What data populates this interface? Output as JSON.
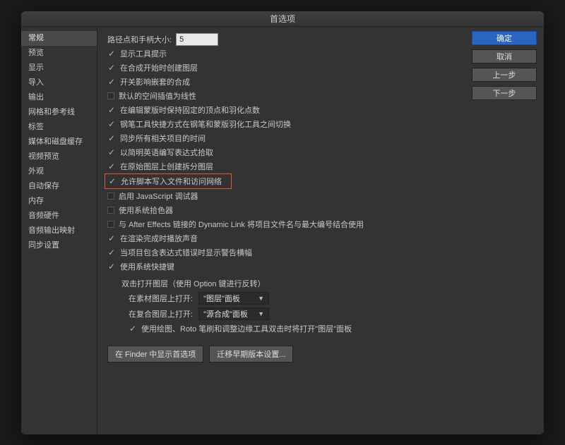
{
  "window": {
    "title": "首选项"
  },
  "sidebar": {
    "items": [
      {
        "label": "常规",
        "selected": true
      },
      {
        "label": "预览",
        "selected": false
      },
      {
        "label": "显示",
        "selected": false
      },
      {
        "label": "导入",
        "selected": false
      },
      {
        "label": "输出",
        "selected": false
      },
      {
        "label": "网格和参考线",
        "selected": false
      },
      {
        "label": "标签",
        "selected": false
      },
      {
        "label": "媒体和磁盘缓存",
        "selected": false
      },
      {
        "label": "视频预览",
        "selected": false
      },
      {
        "label": "外观",
        "selected": false
      },
      {
        "label": "自动保存",
        "selected": false
      },
      {
        "label": "内存",
        "selected": false
      },
      {
        "label": "音频硬件",
        "selected": false
      },
      {
        "label": "音频输出映射",
        "selected": false
      },
      {
        "label": "同步设置",
        "selected": false
      }
    ]
  },
  "buttons": {
    "ok": "确定",
    "cancel": "取消",
    "prev": "上一步",
    "next": "下一步"
  },
  "general": {
    "pathPointLabel": "路径点和手柄大小:",
    "pathPointValue": "5",
    "options": [
      {
        "checked": true,
        "label": "显示工具提示"
      },
      {
        "checked": true,
        "label": "在合成开始时创建图层"
      },
      {
        "checked": true,
        "label": "开关影响嵌套的合成"
      },
      {
        "checked": false,
        "label": "默认的空间插值为线性"
      },
      {
        "checked": true,
        "label": "在编辑蒙版时保持固定的顶点和羽化点数"
      },
      {
        "checked": true,
        "label": "钢笔工具快捷方式在钢笔和蒙版羽化工具之间切换"
      },
      {
        "checked": true,
        "label": "同步所有相关项目的时间"
      },
      {
        "checked": true,
        "label": "以简明英语编写表达式拾取"
      },
      {
        "checked": true,
        "label": "在原始图层上创建拆分图层"
      },
      {
        "checked": true,
        "label": "允许脚本写入文件和访问网络",
        "highlight": true
      },
      {
        "checked": false,
        "label": "启用 JavaScript 调试器"
      },
      {
        "checked": false,
        "label": "使用系统拾色器"
      },
      {
        "checked": false,
        "label": "与 After Effects 链接的 Dynamic Link 将项目文件名与最大编号结合使用"
      },
      {
        "checked": true,
        "label": "在渲染完成时播放声音"
      },
      {
        "checked": true,
        "label": "当项目包含表达式错误时显示警告横幅"
      },
      {
        "checked": true,
        "label": "使用系统快捷键"
      }
    ],
    "doubleClick": {
      "header": "双击打开图层（使用 Option 键进行反转）",
      "row1Label": "在素材图层上打开:",
      "row1Value": "\"图层\"面板",
      "row2Label": "在复合图层上打开:",
      "row2Value": "\"源合成\"面板",
      "rotoLabel": "使用绘图、Roto 笔刷和调整边缘工具双击时将打开\"图层\"面板",
      "rotoChecked": true
    },
    "bottom": {
      "revealFinder": "在 Finder 中显示首选项",
      "migrate": "迁移早期版本设置..."
    }
  }
}
